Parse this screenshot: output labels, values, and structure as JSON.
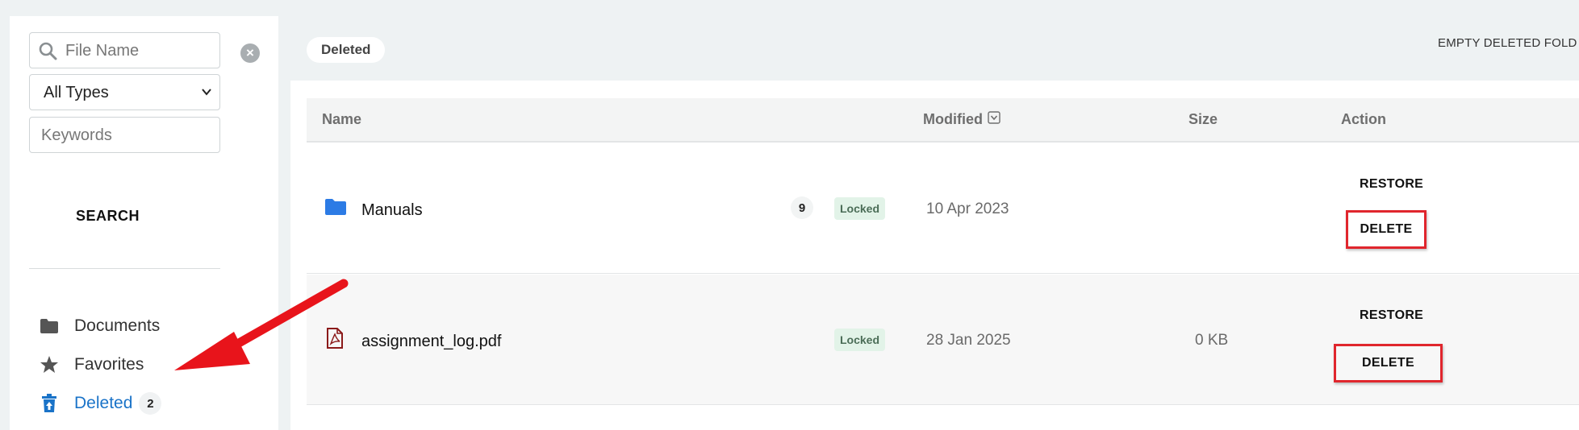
{
  "sidebar": {
    "search_placeholder": "File Name",
    "type_select_value": "All Types",
    "keywords_placeholder": "Keywords",
    "search_button": "SEARCH",
    "nav": [
      {
        "label": "Documents",
        "icon": "folder-icon"
      },
      {
        "label": "Favorites",
        "icon": "star-icon"
      },
      {
        "label": "Deleted",
        "icon": "trash-restore-icon",
        "badge": "2",
        "active": true
      }
    ]
  },
  "main": {
    "breadcrumb": "Deleted",
    "empty_button": "EMPTY DELETED FOLD",
    "columns": {
      "name": "Name",
      "modified": "Modified",
      "size": "Size",
      "action": "Action"
    },
    "rows": [
      {
        "name": "Manuals",
        "type": "folder",
        "count": "9",
        "status": "Locked",
        "modified": "10 Apr 2023",
        "size": "",
        "restore": "RESTORE",
        "delete": "DELETE"
      },
      {
        "name": "assignment_log.pdf",
        "type": "pdf",
        "count": "",
        "status": "Locked",
        "modified": "28 Jan 2025",
        "size": "0 KB",
        "restore": "RESTORE",
        "delete": "DELETE"
      }
    ]
  },
  "colors": {
    "accent": "#1a73c8",
    "highlight": "#e0262d",
    "locked_bg": "#e2f3e8",
    "folder_icon": "#2c7be5",
    "pdf_icon": "#8b1a1a"
  }
}
